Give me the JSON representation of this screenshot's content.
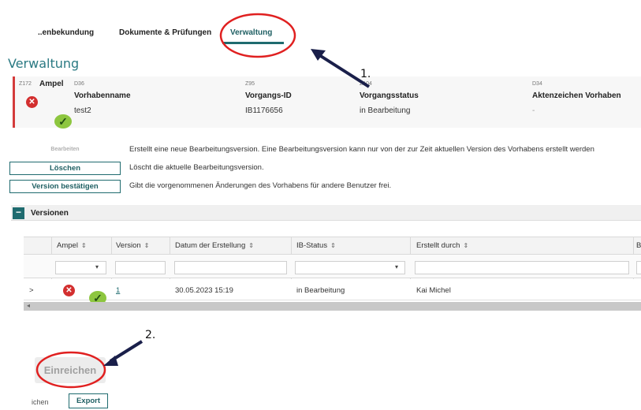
{
  "tabs": {
    "tab1": "..enbekundung",
    "tab2": "Dokumente & Prüfungen",
    "tab3": "Verwaltung"
  },
  "page_title": "Verwaltung",
  "header": {
    "ampel_code": "Z172",
    "ampel_label": "Ampel",
    "name_code": "D36",
    "name_label": "Vorhabenname",
    "name_value": "test2",
    "id_code": "Z95",
    "id_label": "Vorgangs-ID",
    "id_value": "IB1176656",
    "status_code": "Z104",
    "status_label": "Vorgangsstatus",
    "status_value": "in Bearbeitung",
    "az_code": "D34",
    "az_label": "Aktenzeichen Vorhaben",
    "az_value": "-"
  },
  "actions": [
    {
      "label": "Bearbeiten",
      "desc": "Erstellt eine neue Bearbeitungsversion. Eine Bearbeitungsversion kann nur von der zur Zeit aktuellen Version des Vorhabens erstellt werden"
    },
    {
      "label": "Löschen",
      "desc": "Löscht die aktuelle Bearbeitungsversion."
    },
    {
      "label": "Version bestätigen",
      "desc": "Gibt die vorgenommenen Änderungen des Vorhabens für andere Benutzer frei."
    }
  ],
  "versions": {
    "toggle": "−",
    "title": "Versionen",
    "columns": [
      "Ampel",
      "Version",
      "Datum der Erstellung",
      "IB-Status",
      "Erstellt durch",
      "B"
    ],
    "sort_glyph": "⇕",
    "rows": [
      {
        "expand": ">",
        "version": "1",
        "date": "30.05.2023 15:19",
        "ib_status": "in Bearbeitung",
        "created_by": "Kai Michel"
      }
    ]
  },
  "submit_label": "Einreichen",
  "bottom": {
    "partial": "ichen",
    "export_label": "Export"
  },
  "annotations": [
    "1.",
    "2."
  ],
  "colors": {
    "accent": "#1f6b6f",
    "title": "#2b7a83",
    "error": "#d32f2f",
    "ok": "#8dc63f",
    "annotation_red": "#e02020",
    "annotation_arrow": "#1a1f4a"
  }
}
